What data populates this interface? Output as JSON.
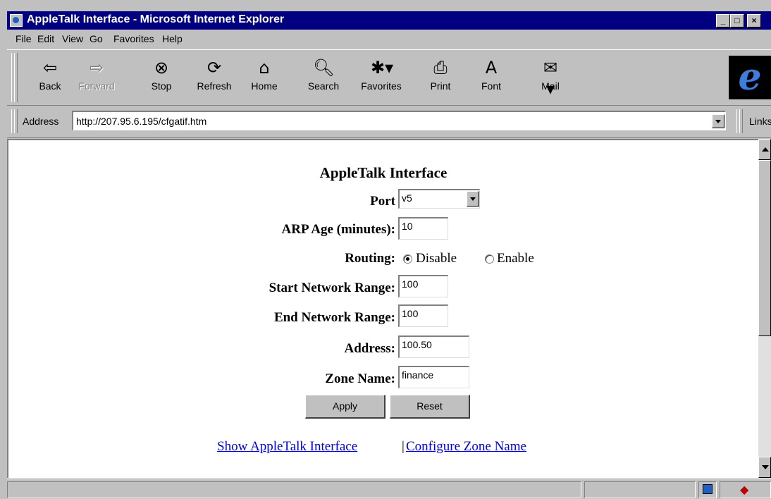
{
  "window": {
    "title": "AppleTalk Interface - Microsoft Internet Explorer",
    "controls": [
      "_",
      "□",
      "×"
    ]
  },
  "menu": [
    "File",
    "Edit",
    "View",
    "Go",
    "Favorites",
    "Help"
  ],
  "toolbar": [
    {
      "label": "Back",
      "icon": "back-arrow-icon",
      "enabled": true
    },
    {
      "label": "Forward",
      "icon": "forward-arrow-icon",
      "enabled": false
    },
    {
      "label": "Stop",
      "icon": "stop-icon",
      "enabled": true
    },
    {
      "label": "Refresh",
      "icon": "refresh-icon",
      "enabled": true
    },
    {
      "label": "Home",
      "icon": "home-icon",
      "enabled": true
    },
    {
      "label": "Search",
      "icon": "search-icon",
      "enabled": true
    },
    {
      "label": "Favorites",
      "icon": "favorites-icon",
      "enabled": true
    },
    {
      "label": "Print",
      "icon": "print-icon",
      "enabled": true
    },
    {
      "label": "Font",
      "icon": "font-icon",
      "enabled": true
    },
    {
      "label": "Mail",
      "icon": "mail-icon",
      "enabled": true
    }
  ],
  "address": {
    "label": "Address",
    "value": "http://207.95.6.195/cfgatif.htm",
    "links_label": "Links"
  },
  "page": {
    "title": "AppleTalk Interface",
    "port": {
      "label": "Port",
      "value": "v5"
    },
    "arp_age": {
      "label": "ARP Age (minutes):",
      "value": "10"
    },
    "routing": {
      "label": "Routing:",
      "options": [
        "Disable",
        "Enable"
      ],
      "selected": "Disable"
    },
    "start_range": {
      "label": "Start Network Range:",
      "value": "100"
    },
    "end_range": {
      "label": "End Network Range:",
      "value": "100"
    },
    "address": {
      "label": "Address:",
      "value": "100.50"
    },
    "zone_name": {
      "label": "Zone Name:",
      "value": "finance"
    },
    "buttons": {
      "apply": "Apply",
      "reset": "Reset"
    },
    "links": {
      "show": "Show AppleTalk Interface",
      "separator": "|",
      "configure": "Configure Zone Name"
    }
  },
  "colors": {
    "titlebar": "#000080",
    "chrome": "#c0c0c0",
    "link": "#0000ee"
  }
}
